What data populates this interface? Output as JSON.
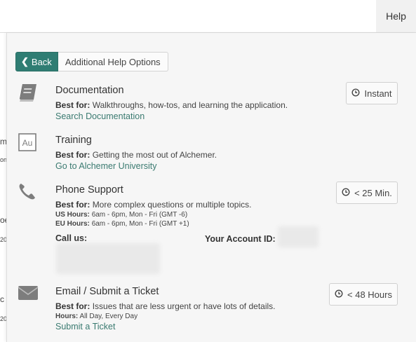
{
  "header": {
    "help_label": "Help"
  },
  "nav": {
    "back_label": "Back",
    "breadcrumb": "Additional Help Options"
  },
  "sections": [
    {
      "title": "Documentation",
      "best_for_label": "Best for:",
      "best_for": "Walkthroughs, how-tos, and learning the application.",
      "link": "Search Documentation",
      "badge": "Instant",
      "icon": "book-icon"
    },
    {
      "title": "Training",
      "best_for_label": "Best for:",
      "best_for": "Getting the most out of Alchemer.",
      "link": "Go to Alchemer University",
      "icon": "alchemer-university-icon"
    },
    {
      "title": "Phone Support",
      "best_for_label": "Best for:",
      "best_for": "More complex questions or multiple topics.",
      "us_hours_label": "US Hours:",
      "us_hours": "6am - 6pm, Mon - Fri (GMT -6)",
      "eu_hours_label": "EU Hours:",
      "eu_hours": "6am - 6pm, Mon - Fri (GMT +1)",
      "call_us_label": "Call us:",
      "account_id_label": "Your Account ID:",
      "badge": "< 25 Min.",
      "icon": "phone-icon"
    },
    {
      "title": "Email / Submit a Ticket",
      "best_for_label": "Best for:",
      "best_for": "Issues that are less urgent or have lots of details.",
      "hours_label": "Hours:",
      "hours": "All Day, Every Day",
      "link": "Submit a Ticket",
      "badge": "< 48 Hours",
      "icon": "envelope-icon"
    }
  ],
  "background_fragments": [
    "m",
    "on",
    "oe",
    "20",
    "c",
    "20"
  ],
  "colors": {
    "accent": "#2f7d73",
    "link": "#3a7a70",
    "panel_bg": "#f6f6f6"
  }
}
